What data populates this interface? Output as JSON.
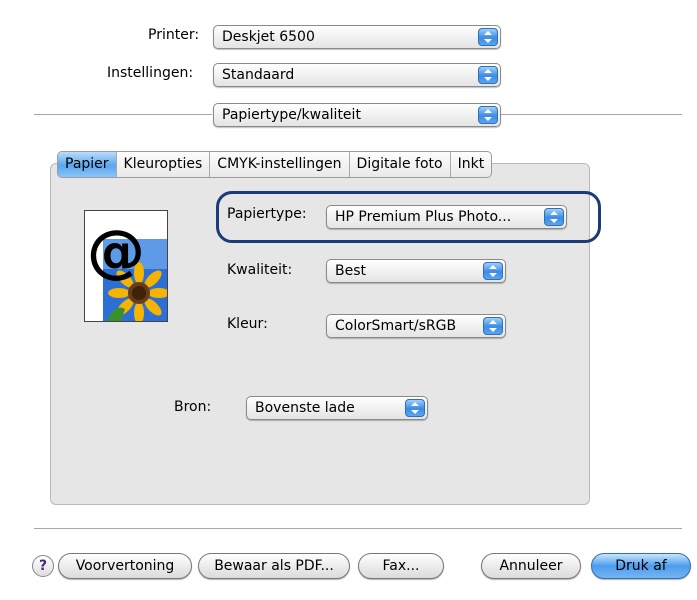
{
  "printer": {
    "label": "Printer:",
    "value": "Deskjet 6500"
  },
  "presets": {
    "label": "Instellingen:",
    "value": "Standaard"
  },
  "panel_menu": {
    "value": "Papiertype/kwaliteit"
  },
  "tabs": [
    {
      "label": "Papier",
      "active": true
    },
    {
      "label": "Kleuropties",
      "active": false
    },
    {
      "label": "CMYK-instellingen",
      "active": false
    },
    {
      "label": "Digitale foto",
      "active": false
    },
    {
      "label": "Inkt",
      "active": false
    }
  ],
  "paper_type": {
    "label": "Papiertype:",
    "value": "HP Premium Plus Photo..."
  },
  "quality": {
    "label": "Kwaliteit:",
    "value": "Best"
  },
  "color": {
    "label": "Kleur:",
    "value": "ColorSmart/sRGB"
  },
  "source": {
    "label": "Bron:",
    "value": "Bovenste lade"
  },
  "buttons": {
    "help": "?",
    "preview": "Voorvertoning",
    "save_pdf": "Bewaar als PDF...",
    "fax": "Fax...",
    "cancel": "Annuleer",
    "print": "Druk af"
  },
  "colors": {
    "accent": "#3b8be6",
    "highlight_border": "#1a3a78"
  }
}
